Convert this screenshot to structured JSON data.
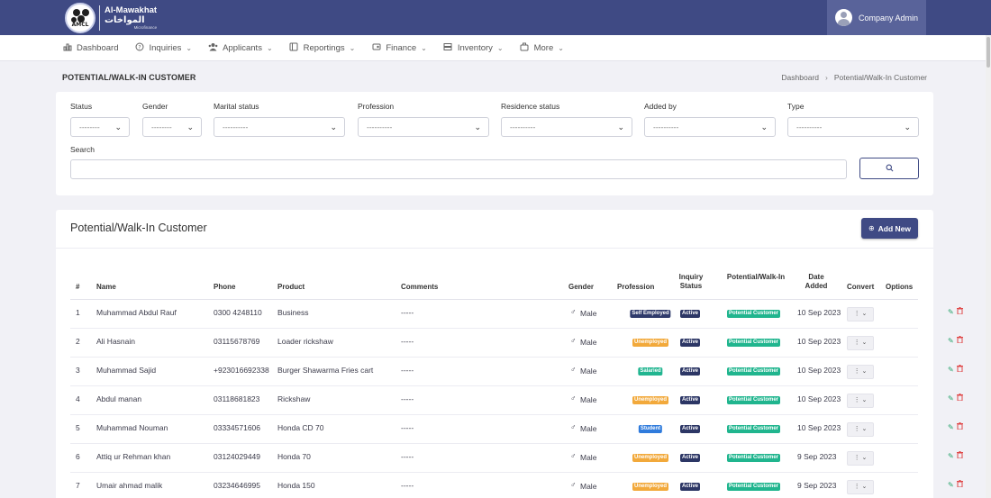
{
  "header": {
    "logo": {
      "name_en": "Al-Mawakhat",
      "name_ar": "المواخات",
      "tagline": "Microfinance",
      "abbr": "AMCL"
    },
    "user": {
      "name": "Company Admin"
    }
  },
  "nav": [
    {
      "label": "Dashboard",
      "icon": "bar-chart-icon",
      "has_dropdown": false
    },
    {
      "label": "Inquiries",
      "icon": "question-circle-icon",
      "has_dropdown": true
    },
    {
      "label": "Applicants",
      "icon": "users-icon",
      "has_dropdown": true
    },
    {
      "label": "Reportings",
      "icon": "report-icon",
      "has_dropdown": true
    },
    {
      "label": "Finance",
      "icon": "finance-icon",
      "has_dropdown": true
    },
    {
      "label": "Inventory",
      "icon": "inventory-icon",
      "has_dropdown": true
    },
    {
      "label": "More",
      "icon": "briefcase-icon",
      "has_dropdown": true
    }
  ],
  "page": {
    "title": "POTENTIAL/WALK-IN CUSTOMER",
    "breadcrumb": [
      "Dashboard",
      "Potential/Walk-In Customer"
    ]
  },
  "filters": {
    "status": {
      "label": "Status",
      "value": "--------"
    },
    "gender": {
      "label": "Gender",
      "value": "--------"
    },
    "marital_status": {
      "label": "Marital status",
      "value": "----------"
    },
    "profession": {
      "label": "Profession",
      "value": "----------"
    },
    "residence_status": {
      "label": "Residence status",
      "value": "----------"
    },
    "added_by": {
      "label": "Added by",
      "value": "----------"
    },
    "type": {
      "label": "Type",
      "value": "----------"
    },
    "search": {
      "label": "Search",
      "value": ""
    }
  },
  "table": {
    "title": "Potential/Walk-In Customer",
    "add_button_label": "Add New",
    "columns": {
      "num": "#",
      "name": "Name",
      "phone": "Phone",
      "product": "Product",
      "comments": "Comments",
      "gender": "Gender",
      "profession": "Profession",
      "inquiry_status": "Inquiry Status",
      "potential": "Potential/Walk-In",
      "date_added": "Date Added",
      "convert": "Convert",
      "options": "Options"
    },
    "rows": [
      {
        "num": "1",
        "name": "Muhammad Abdul Rauf",
        "phone": "0300 4248110",
        "product": "Business",
        "comments": "-----",
        "gender": "Male",
        "profession": "Self Employed",
        "profession_type": "self",
        "inquiry_status": "Active",
        "potential": "Potential Customer",
        "date_added": "10 Sep 2023"
      },
      {
        "num": "2",
        "name": "Ali Hasnain",
        "phone": "03115678769",
        "product": "Loader rickshaw",
        "comments": "-----",
        "gender": "Male",
        "profession": "Unemployed",
        "profession_type": "unemp",
        "inquiry_status": "Active",
        "potential": "Potential Customer",
        "date_added": "10 Sep 2023"
      },
      {
        "num": "3",
        "name": "Muhammad Sajid",
        "phone": "+923016692338",
        "product": "Burger Shawarma Fries cart",
        "comments": "-----",
        "gender": "Male",
        "profession": "Salaried",
        "profession_type": "sal",
        "inquiry_status": "Active",
        "potential": "Potential Customer",
        "date_added": "10 Sep 2023"
      },
      {
        "num": "4",
        "name": "Abdul manan",
        "phone": "03118681823",
        "product": "Rickshaw",
        "comments": "-----",
        "gender": "Male",
        "profession": "Unemployed",
        "profession_type": "unemp",
        "inquiry_status": "Active",
        "potential": "Potential Customer",
        "date_added": "10 Sep 2023"
      },
      {
        "num": "5",
        "name": "Muhammad Nouman",
        "phone": "03334571606",
        "product": "Honda CD 70",
        "comments": "-----",
        "gender": "Male",
        "profession": "Student",
        "profession_type": "stud",
        "inquiry_status": "Active",
        "potential": "Potential Customer",
        "date_added": "10 Sep 2023"
      },
      {
        "num": "6",
        "name": "Attiq ur Rehman khan",
        "phone": "03124029449",
        "product": "Honda 70",
        "comments": "-----",
        "gender": "Male",
        "profession": "Unemployed",
        "profession_type": "unemp",
        "inquiry_status": "Active",
        "potential": "Potential Customer",
        "date_added": "9 Sep 2023"
      },
      {
        "num": "7",
        "name": "Umair ahmad malik",
        "phone": "03234646995",
        "product": "Honda 150",
        "comments": "-----",
        "gender": "Male",
        "profession": "Unemployed",
        "profession_type": "unemp",
        "inquiry_status": "Active",
        "potential": "Potential Customer",
        "date_added": "9 Sep 2023"
      }
    ]
  },
  "colors": {
    "brand": "#3f4a84",
    "self_employed": "#2f3a6b",
    "unemployed": "#f2a93b",
    "salaried": "#21b590",
    "student": "#2f7bdc",
    "active": "#2c3665",
    "potential": "#20b58e"
  }
}
